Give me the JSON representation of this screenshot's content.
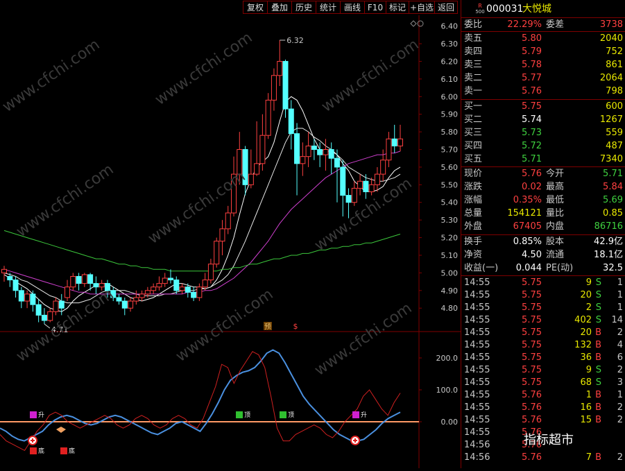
{
  "toolbar": {
    "buttons": [
      "复权",
      "叠加",
      "历史",
      "统计",
      "画线",
      "F10",
      "标记",
      "+自选",
      "返回"
    ]
  },
  "header": {
    "badge_top": "R",
    "badge_bottom": "500",
    "code": "000031",
    "name": "大悦城"
  },
  "quote": {
    "weibi_label": "委比",
    "weibi_value": "22.29%",
    "weicha_label": "委差",
    "weicha_value": "3738",
    "asks": [
      {
        "label": "卖五",
        "price": "5.80",
        "vol": "2040"
      },
      {
        "label": "卖四",
        "price": "5.79",
        "vol": "752"
      },
      {
        "label": "卖三",
        "price": "5.78",
        "vol": "861"
      },
      {
        "label": "卖二",
        "price": "5.77",
        "vol": "2064"
      },
      {
        "label": "卖一",
        "price": "5.76",
        "vol": "798"
      }
    ],
    "bids": [
      {
        "label": "买一",
        "price": "5.75",
        "vol": "600"
      },
      {
        "label": "买二",
        "price": "5.74",
        "vol": "1267"
      },
      {
        "label": "买三",
        "price": "5.73",
        "vol": "559"
      },
      {
        "label": "买四",
        "price": "5.72",
        "vol": "487"
      },
      {
        "label": "买五",
        "price": "5.71",
        "vol": "7340"
      }
    ],
    "stats": [
      {
        "l1": "现价",
        "v1": "5.76",
        "l2": "今开",
        "v2": "5.71"
      },
      {
        "l1": "涨跌",
        "v1": "0.02",
        "l2": "最高",
        "v2": "5.84"
      },
      {
        "l1": "涨幅",
        "v1": "0.35%",
        "l2": "最低",
        "v2": "5.69"
      },
      {
        "l1": "总量",
        "v1": "154121",
        "l2": "量比",
        "v2": "0.85"
      },
      {
        "l1": "外盘",
        "v1": "67405",
        "l2": "内盘",
        "v2": "86716"
      }
    ],
    "fund": [
      {
        "l1": "换手",
        "v1": "0.85%",
        "l2": "股本",
        "v2": "42.9亿"
      },
      {
        "l1": "净资",
        "v1": "4.50",
        "l2": "流通",
        "v2": "18.1亿"
      },
      {
        "l1": "收益(一)",
        "v1": "0.044",
        "l2": "PE(动)",
        "v2": "32.5"
      }
    ]
  },
  "ticks": [
    {
      "t": "14:55",
      "p": "5.75",
      "v": "9",
      "s": "S",
      "n": "1"
    },
    {
      "t": "14:55",
      "p": "5.75",
      "v": "20",
      "s": "S",
      "n": "1"
    },
    {
      "t": "14:55",
      "p": "5.75",
      "v": "2",
      "s": "S",
      "n": "1"
    },
    {
      "t": "14:55",
      "p": "5.75",
      "v": "402",
      "s": "S",
      "n": "14"
    },
    {
      "t": "14:55",
      "p": "5.75",
      "v": "20",
      "s": "B",
      "n": "2"
    },
    {
      "t": "14:55",
      "p": "5.75",
      "v": "132",
      "s": "B",
      "n": "4"
    },
    {
      "t": "14:55",
      "p": "5.75",
      "v": "36",
      "s": "B",
      "n": "6"
    },
    {
      "t": "14:55",
      "p": "5.75",
      "v": "9",
      "s": "S",
      "n": "2"
    },
    {
      "t": "14:55",
      "p": "5.75",
      "v": "68",
      "s": "S",
      "n": "3"
    },
    {
      "t": "14:55",
      "p": "5.76",
      "v": "1",
      "s": "B",
      "n": "1"
    },
    {
      "t": "14:55",
      "p": "5.76",
      "v": "16",
      "s": "B",
      "n": "2"
    },
    {
      "t": "14:55",
      "p": "5.76",
      "v": "15",
      "s": "B",
      "n": "2"
    },
    {
      "t": "14:55",
      "p": "5.76",
      "v": "",
      "s": "",
      "n": ""
    },
    {
      "t": "14:56",
      "p": "5.76",
      "v": "",
      "s": "",
      "n": ""
    },
    {
      "t": "14:56",
      "p": "5.76",
      "v": "7",
      "s": "B",
      "n": "2"
    }
  ],
  "watermark": {
    "site": "www.cfchi.com",
    "brand": "指标超市"
  },
  "colors": {
    "up": "#ff4040",
    "down": "#54ffff",
    "frame": "#7f0000",
    "ma5": "#ffffff",
    "ma10": "#e8e8e8",
    "ma20": "#d040d0",
    "ma60": "#3cc83c",
    "osc_blue": "#4a90e0",
    "osc_red": "#d02020",
    "zero_line": "#ff9966"
  },
  "chart_data": {
    "type": "candlestick",
    "price_axis": {
      "min": 4.8,
      "max": 6.4,
      "ticks": [
        "6.40",
        "6.30",
        "6.20",
        "6.10",
        "6.00",
        "5.90",
        "5.80",
        "5.70",
        "5.60",
        "5.50",
        "5.40",
        "5.30",
        "5.20",
        "5.10",
        "5.00",
        "4.90",
        "4.80"
      ]
    },
    "high_label": "6.32",
    "low_label": "4.71",
    "markers": [
      "预",
      "$"
    ],
    "candles": [
      [
        5.0,
        5.02,
        4.95,
        5.04
      ],
      [
        4.98,
        4.96,
        4.92,
        5.0
      ],
      [
        4.96,
        4.9,
        4.86,
        4.98
      ],
      [
        4.9,
        4.84,
        4.8,
        4.92
      ],
      [
        4.84,
        4.88,
        4.8,
        4.9
      ],
      [
        4.88,
        4.82,
        4.78,
        4.9
      ],
      [
        4.82,
        4.76,
        4.72,
        4.85
      ],
      [
        4.76,
        4.73,
        4.71,
        4.8
      ],
      [
        4.73,
        4.78,
        4.72,
        4.8
      ],
      [
        4.78,
        4.84,
        4.76,
        4.86
      ],
      [
        4.84,
        4.8,
        4.76,
        4.88
      ],
      [
        4.86,
        4.92,
        4.84,
        4.96
      ],
      [
        4.92,
        4.98,
        4.9,
        5.0
      ],
      [
        4.98,
        4.94,
        4.9,
        5.0
      ],
      [
        4.94,
        4.99,
        4.92,
        5.0
      ],
      [
        4.99,
        4.94,
        4.9,
        5.0
      ],
      [
        4.94,
        4.92,
        4.88,
        4.98
      ],
      [
        4.92,
        4.94,
        4.9,
        4.96
      ],
      [
        4.94,
        4.9,
        4.86,
        4.96
      ],
      [
        4.9,
        4.86,
        4.84,
        4.92
      ],
      [
        4.86,
        4.84,
        4.82,
        4.88
      ],
      [
        4.84,
        4.8,
        4.76,
        4.86
      ],
      [
        4.8,
        4.84,
        4.78,
        4.86
      ],
      [
        4.84,
        4.86,
        4.82,
        4.9
      ],
      [
        4.86,
        4.88,
        4.84,
        4.9
      ],
      [
        4.88,
        4.9,
        4.86,
        4.92
      ],
      [
        4.9,
        4.92,
        4.88,
        4.94
      ],
      [
        4.92,
        4.94,
        4.9,
        4.98
      ],
      [
        4.94,
        4.97,
        4.92,
        5.0
      ],
      [
        4.97,
        4.96,
        4.94,
        5.02
      ],
      [
        4.96,
        4.9,
        4.88,
        4.98
      ],
      [
        4.9,
        4.92,
        4.88,
        4.94
      ],
      [
        4.92,
        4.89,
        4.86,
        4.94
      ],
      [
        4.89,
        4.86,
        4.84,
        4.92
      ],
      [
        4.86,
        4.92,
        4.84,
        4.94
      ],
      [
        4.92,
        4.96,
        4.9,
        5.0
      ],
      [
        4.96,
        5.05,
        4.94,
        5.08
      ],
      [
        5.05,
        5.18,
        5.03,
        5.2
      ],
      [
        5.18,
        5.25,
        5.1,
        5.3
      ],
      [
        5.25,
        5.34,
        5.22,
        5.38
      ],
      [
        5.34,
        5.56,
        5.32,
        5.66
      ],
      [
        5.56,
        5.7,
        5.5,
        5.8
      ],
      [
        5.7,
        5.5,
        5.44,
        5.72
      ],
      [
        5.5,
        5.56,
        5.48,
        5.7
      ],
      [
        5.56,
        5.62,
        5.55,
        5.86
      ],
      [
        5.62,
        5.78,
        5.58,
        5.9
      ],
      [
        5.78,
        5.98,
        5.76,
        6.02
      ],
      [
        5.98,
        6.12,
        5.92,
        6.16
      ],
      [
        6.12,
        6.2,
        6.06,
        6.32
      ],
      [
        6.2,
        5.93,
        5.88,
        6.21
      ],
      [
        5.93,
        5.79,
        5.7,
        5.98
      ],
      [
        5.79,
        5.62,
        5.44,
        5.85
      ],
      [
        5.62,
        5.66,
        5.55,
        5.74
      ],
      [
        5.66,
        5.72,
        5.6,
        5.8
      ],
      [
        5.72,
        5.7,
        5.64,
        5.76
      ],
      [
        5.7,
        5.67,
        5.6,
        5.74
      ],
      [
        5.67,
        5.7,
        5.58,
        5.76
      ],
      [
        5.7,
        5.65,
        5.56,
        5.74
      ],
      [
        5.65,
        5.6,
        5.4,
        5.7
      ],
      [
        5.6,
        5.44,
        5.32,
        5.64
      ],
      [
        5.44,
        5.4,
        5.31,
        5.48
      ],
      [
        5.4,
        5.48,
        5.38,
        5.52
      ],
      [
        5.48,
        5.52,
        5.44,
        5.56
      ],
      [
        5.52,
        5.46,
        5.42,
        5.56
      ],
      [
        5.46,
        5.5,
        5.44,
        5.54
      ],
      [
        5.5,
        5.56,
        5.46,
        5.6
      ],
      [
        5.56,
        5.64,
        5.52,
        5.7
      ],
      [
        5.64,
        5.76,
        5.6,
        5.8
      ],
      [
        5.76,
        5.72,
        5.68,
        5.84
      ],
      [
        5.72,
        5.76,
        5.69,
        5.84
      ]
    ],
    "ma_series": {
      "ma5": [
        4.99,
        4.97,
        4.95,
        4.93,
        4.91,
        4.88,
        4.85,
        4.82,
        4.8,
        4.79,
        4.78,
        4.8,
        4.84,
        4.87,
        4.89,
        4.91,
        4.93,
        4.94,
        4.94,
        4.92,
        4.9,
        4.88,
        4.86,
        4.85,
        4.84,
        4.85,
        4.86,
        4.88,
        4.9,
        4.92,
        4.94,
        4.94,
        4.93,
        4.92,
        4.92,
        4.91,
        4.92,
        4.96,
        5.02,
        5.1,
        5.2,
        5.33,
        5.45,
        5.53,
        5.6,
        5.63,
        5.66,
        5.74,
        5.86,
        5.97,
        6.0,
        5.98,
        5.92,
        5.84,
        5.76,
        5.7,
        5.69,
        5.69,
        5.67,
        5.62,
        5.58,
        5.52,
        5.49,
        5.46,
        5.46,
        5.47,
        5.49,
        5.54,
        5.58,
        5.6
      ],
      "ma10": [
        5.0,
        4.99,
        4.98,
        4.96,
        4.95,
        4.93,
        4.91,
        4.89,
        4.87,
        4.86,
        4.84,
        4.83,
        4.83,
        4.83,
        4.84,
        4.85,
        4.87,
        4.89,
        4.9,
        4.9,
        4.9,
        4.9,
        4.89,
        4.88,
        4.87,
        4.87,
        4.87,
        4.87,
        4.88,
        4.88,
        4.89,
        4.9,
        4.9,
        4.9,
        4.91,
        4.91,
        4.92,
        4.94,
        4.96,
        4.99,
        5.04,
        5.11,
        5.18,
        5.26,
        5.34,
        5.42,
        5.5,
        5.58,
        5.66,
        5.74,
        5.8,
        5.82,
        5.82,
        5.8,
        5.77,
        5.75,
        5.72,
        5.7,
        5.67,
        5.64,
        5.6,
        5.58,
        5.56,
        5.54,
        5.53,
        5.52,
        5.52,
        5.53,
        5.54,
        5.56
      ],
      "ma20": [
        5.02,
        5.01,
        5.0,
        4.99,
        4.98,
        4.97,
        4.96,
        4.95,
        4.94,
        4.93,
        4.92,
        4.91,
        4.9,
        4.89,
        4.89,
        4.88,
        4.88,
        4.88,
        4.88,
        4.88,
        4.88,
        4.88,
        4.88,
        4.88,
        4.88,
        4.88,
        4.88,
        4.88,
        4.88,
        4.88,
        4.88,
        4.88,
        4.89,
        4.89,
        4.89,
        4.9,
        4.9,
        4.91,
        4.93,
        4.95,
        4.97,
        5.0,
        5.03,
        5.06,
        5.1,
        5.14,
        5.18,
        5.23,
        5.28,
        5.32,
        5.36,
        5.39,
        5.42,
        5.45,
        5.48,
        5.51,
        5.54,
        5.56,
        5.58,
        5.6,
        5.62,
        5.63,
        5.64,
        5.65,
        5.66,
        5.67,
        5.67,
        5.68,
        5.68,
        5.69
      ],
      "ma60": [
        5.24,
        5.23,
        5.22,
        5.21,
        5.2,
        5.19,
        5.18,
        5.17,
        5.16,
        5.15,
        5.14,
        5.13,
        5.12,
        5.11,
        5.1,
        5.09,
        5.08,
        5.08,
        5.07,
        5.06,
        5.05,
        5.05,
        5.04,
        5.04,
        5.03,
        5.03,
        5.02,
        5.02,
        5.02,
        5.01,
        5.01,
        5.01,
        5.01,
        5.01,
        5.01,
        5.01,
        5.01,
        5.01,
        5.02,
        5.02,
        5.03,
        5.03,
        5.04,
        5.05,
        5.05,
        5.06,
        5.07,
        5.08,
        5.08,
        5.09,
        5.1,
        5.1,
        5.11,
        5.11,
        5.12,
        5.13,
        5.13,
        5.14,
        5.14,
        5.15,
        5.15,
        5.16,
        5.16,
        5.17,
        5.17,
        5.18,
        5.19,
        5.2,
        5.21,
        5.22
      ]
    },
    "oscillator": {
      "axis_ticks": [
        "200.0",
        "100.0",
        "0.00"
      ],
      "blue": [
        -20,
        -30,
        -45,
        -55,
        -60,
        -50,
        -40,
        -30,
        -10,
        5,
        15,
        20,
        15,
        5,
        -5,
        -10,
        -5,
        5,
        15,
        20,
        15,
        5,
        -5,
        -15,
        -25,
        -35,
        -40,
        -30,
        -20,
        -5,
        0,
        -10,
        -20,
        -30,
        -5,
        25,
        60,
        100,
        130,
        145,
        155,
        160,
        170,
        190,
        215,
        225,
        215,
        185,
        150,
        115,
        80,
        55,
        35,
        15,
        -5,
        -25,
        -40,
        -50,
        -60,
        -60,
        -55,
        -40,
        -25,
        -5,
        10,
        20,
        30
      ],
      "red": [
        -40,
        -60,
        -70,
        -80,
        -90,
        -60,
        -30,
        -10,
        20,
        30,
        20,
        0,
        -10,
        -20,
        -10,
        0,
        10,
        20,
        10,
        -10,
        -20,
        -10,
        10,
        20,
        10,
        -10,
        -20,
        -10,
        10,
        20,
        10,
        -10,
        -20,
        10,
        60,
        110,
        180,
        170,
        120,
        160,
        190,
        220,
        210,
        170,
        80,
        -20,
        -60,
        -60,
        -40,
        -30,
        -20,
        -10,
        -20,
        -40,
        -50,
        -30,
        0,
        20,
        40,
        80,
        100,
        70,
        40,
        20,
        60,
        90
      ]
    },
    "signals": [
      "升",
      "顶",
      "顶",
      "升",
      "底",
      "底"
    ]
  }
}
